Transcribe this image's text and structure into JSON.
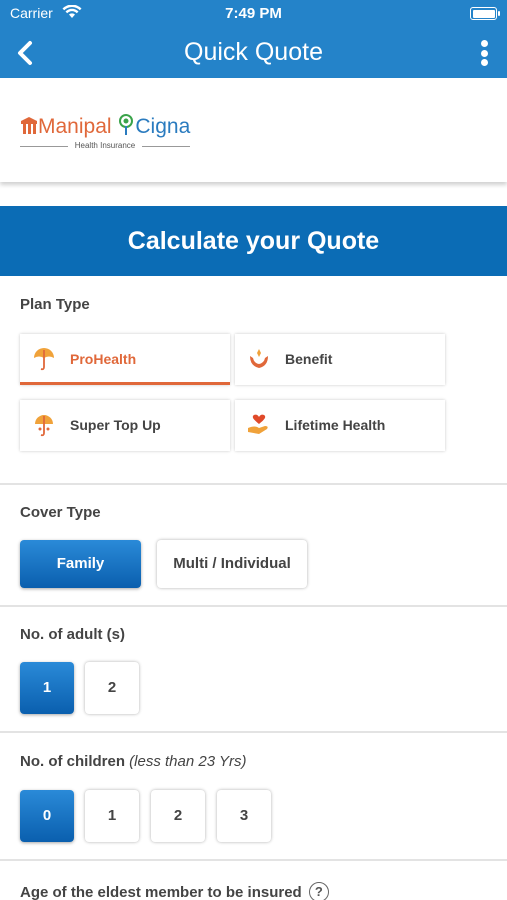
{
  "status": {
    "carrier": "Carrier",
    "time": "7:49 PM"
  },
  "nav": {
    "title": "Quick Quote"
  },
  "logo": {
    "brand_left": "Manipal",
    "brand_right": "Cigna",
    "tagline": "Health Insurance"
  },
  "banner": {
    "title": "Calculate your Quote"
  },
  "plan_type": {
    "label": "Plan Type",
    "options": [
      {
        "label": "ProHealth",
        "icon": "umbrella-icon",
        "selected": true
      },
      {
        "label": "Benefit",
        "icon": "hands-care-icon",
        "selected": false
      },
      {
        "label": "Super Top Up",
        "icon": "umbrella-icon",
        "selected": false
      },
      {
        "label": "Lifetime Health",
        "icon": "heart-hand-icon",
        "selected": false
      }
    ]
  },
  "cover_type": {
    "label": "Cover Type",
    "options": [
      {
        "label": "Family",
        "selected": true
      },
      {
        "label": "Multi / Individual",
        "selected": false
      }
    ]
  },
  "adults": {
    "label": "No. of adult (s)",
    "options": [
      {
        "label": "1",
        "selected": true
      },
      {
        "label": "2",
        "selected": false
      }
    ]
  },
  "children": {
    "label": "No. of children",
    "note": "(less than 23 Yrs)",
    "options": [
      {
        "label": "0",
        "selected": true
      },
      {
        "label": "1",
        "selected": false
      },
      {
        "label": "2",
        "selected": false
      },
      {
        "label": "3",
        "selected": false
      }
    ]
  },
  "eldest": {
    "label": "Age of the eldest member to be insured",
    "help": "?"
  },
  "colors": {
    "primary": "#2483c9",
    "banner": "#0b6cb5",
    "accent": "#e0683a"
  }
}
